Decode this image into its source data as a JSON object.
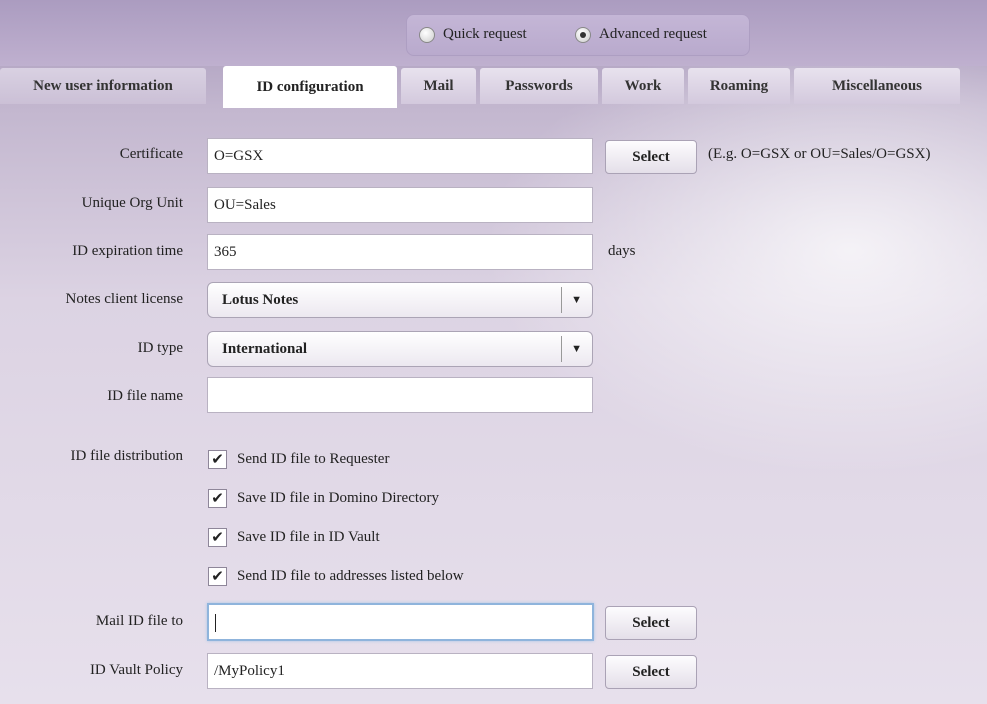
{
  "request_mode": {
    "options": [
      {
        "label": "Quick request",
        "selected": false
      },
      {
        "label": "Advanced request",
        "selected": true
      }
    ]
  },
  "tabs": [
    {
      "label": "New user information",
      "active": false
    },
    {
      "label": "ID configuration",
      "active": true
    },
    {
      "label": "Mail",
      "active": false
    },
    {
      "label": "Passwords",
      "active": false
    },
    {
      "label": "Work",
      "active": false
    },
    {
      "label": "Roaming",
      "active": false
    },
    {
      "label": "Miscellaneous",
      "active": false
    }
  ],
  "form": {
    "certificate": {
      "label": "Certificate",
      "value": "O=GSX",
      "button": "Select",
      "hint": "(E.g. O=GSX or OU=Sales/O=GSX)"
    },
    "unique_org_unit": {
      "label": "Unique Org Unit",
      "value": "OU=Sales"
    },
    "id_expiration": {
      "label": "ID expiration time",
      "value": "365",
      "unit": "days"
    },
    "notes_license": {
      "label": "Notes client license",
      "value": "Lotus Notes"
    },
    "id_type": {
      "label": "ID type",
      "value": "International"
    },
    "id_file_name": {
      "label": "ID file name",
      "value": ""
    },
    "distribution": {
      "label": "ID file distribution",
      "options": [
        {
          "label": "Send ID file to Requester",
          "checked": true
        },
        {
          "label": "Save ID file in Domino Directory",
          "checked": true
        },
        {
          "label": "Save ID file in ID Vault",
          "checked": true
        },
        {
          "label": "Send ID file to addresses listed below",
          "checked": true
        }
      ]
    },
    "mail_id_file_to": {
      "label": "Mail ID file to",
      "value": "",
      "button": "Select"
    },
    "id_vault_policy": {
      "label": "ID Vault Policy",
      "value": "/MyPolicy1",
      "button": "Select"
    }
  },
  "icons": {
    "check": "checkmark-icon",
    "dropdown": "chevron-down-icon"
  }
}
